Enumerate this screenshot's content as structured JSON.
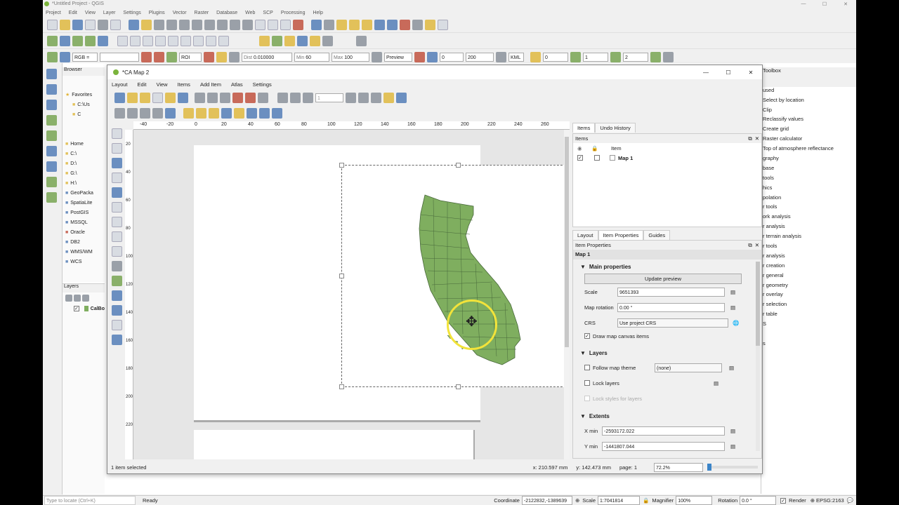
{
  "qgis": {
    "title": "*Untitled Project - QGIS",
    "menu": [
      "Project",
      "Edit",
      "View",
      "Layer",
      "Settings",
      "Plugins",
      "Vector",
      "Raster",
      "Database",
      "Web",
      "SCP",
      "Processing",
      "Help"
    ],
    "scp": {
      "band_label": "RGB =",
      "roi_label": "ROI",
      "dist_label": "Dist",
      "dist_value": "0.010000",
      "min_label": "Min",
      "min_value": "60",
      "max_label": "Max",
      "max_value": "100",
      "preview_label": "Preview",
      "spin1": "0",
      "spin2": "200",
      "kml_label": "KML",
      "s3": "0",
      "s4": "1",
      "s5": "2"
    },
    "browser": {
      "title": "Browser",
      "items": [
        "Favorites",
        "C:\\Us",
        "C",
        "",
        "",
        "Home",
        "C:\\",
        "D:\\",
        "G:\\",
        "H:\\",
        "GeoPacka",
        "SpatiaLite",
        "PostGIS",
        "MSSQL",
        "Oracle",
        "DB2",
        "WMS/WM",
        "WCS"
      ]
    },
    "layers": {
      "title": "Layers",
      "items": [
        "CalBo"
      ]
    },
    "toolbox": {
      "title": "Toolbox",
      "items": [
        "used",
        "Select by location",
        "Clip",
        "Reclassify values",
        "Create grid",
        "Raster calculator",
        "Top of atmosphere reflectance",
        "graphy",
        "base",
        "tools",
        "hics",
        "polation",
        "r tools",
        "ork analysis",
        "r analysis",
        "r terrain analysis",
        "r tools",
        "r analysis",
        "r creation",
        "r general",
        "r geometry",
        "r overlay",
        "r selection",
        "r table",
        "S",
        "",
        "s"
      ]
    },
    "status": {
      "locate_placeholder": "Type to locate (Ctrl+K)",
      "ready": "Ready",
      "coordinate_label": "Coordinate",
      "coordinate": "-2122832,-1389639",
      "scale_label": "Scale",
      "scale": "1:7041814",
      "magnifier_label": "Magnifier",
      "magnifier": "100%",
      "rotation_label": "Rotation",
      "rotation": "0.0 °",
      "render_label": "Render",
      "epsg": "EPSG:2163"
    }
  },
  "layout": {
    "title": "*CA Map 2",
    "menu": [
      "Layout",
      "Edit",
      "View",
      "Items",
      "Add Item",
      "Atlas",
      "Settings"
    ],
    "page_spin": "1",
    "ruler_h": [
      "-40",
      "-20",
      "0",
      "20",
      "40",
      "60",
      "80",
      "100",
      "120",
      "140",
      "160",
      "180",
      "200",
      "220",
      "240",
      "260"
    ],
    "ruler_v": [
      "20",
      "40",
      "60",
      "80",
      "100",
      "120",
      "140",
      "160",
      "180",
      "200",
      "220"
    ],
    "right_panel": {
      "top_tabs": [
        "Items",
        "Undo History"
      ],
      "items_header": "Items",
      "items_column": "Item",
      "item_row": "Map 1",
      "bottom_tabs": [
        "Layout",
        "Item Properties",
        "Guides"
      ],
      "properties_header": "Item Properties",
      "item_name": "Map 1",
      "main_properties": "Main properties",
      "update_preview": "Update preview",
      "scale_label": "Scale",
      "scale_value": "9651393",
      "rotation_label": "Map rotation",
      "rotation_value": "0.00 °",
      "crs_label": "CRS",
      "crs_value": "Use project CRS",
      "draw_canvas_items": "Draw map canvas items",
      "draw_canvas_checked": true,
      "layers_section": "Layers",
      "follow_theme": "Follow map theme",
      "theme_value": "(none)",
      "lock_layers": "Lock layers",
      "lock_styles": "Lock styles for layers",
      "extents_section": "Extents",
      "xmin_label": "X min",
      "xmin_value": "-2593172.022",
      "ymin_label": "Y min",
      "ymin_value": "-1441807.044"
    },
    "status": {
      "selected": "1 item selected",
      "x": "x: 210.597 mm",
      "y": "y: 142.473 mm",
      "page": "page: 1",
      "zoom": "72.2%"
    }
  },
  "colors": {
    "map_fill": "#7fae5f",
    "map_stroke": "#47673a",
    "cursor_ring": "#f2e33a"
  }
}
